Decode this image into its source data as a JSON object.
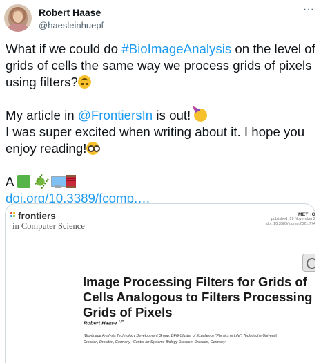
{
  "author": {
    "name": "Robert Haase",
    "handle": "@haesleinhuepf"
  },
  "more_icon": "more-horizontal-icon",
  "tweet": {
    "line1_pre": "What if we could do ",
    "hashtag": "#BioImageAnalysis",
    "line1_post": " on the level of grids of cells the same way we process grids of pixels using filters?",
    "line2_pre": "My article in ",
    "mention": "@FrontiersIn",
    "line2_post": " is out!",
    "line3": "I was super excited when writing about it. I hope you enjoy reading!",
    "line4_pre": "A ",
    "link": "doi.org/10.3389/fcomp.…",
    "link_color": "#1d9bf0",
    "emojis": [
      "upside-down-face",
      "partying-face",
      "nerd-face",
      "green-square",
      "microbe",
      "desktop-computer",
      "thread"
    ]
  },
  "card": {
    "journal_word": "frontiers",
    "journal_sub": "in Computer Science",
    "article_type": "METHO",
    "published": "published: 19 November 2",
    "doi": "doi: 10.3389/fcomp.2021.774",
    "title_lines": [
      "Image Processing Filters for Grids of",
      "Cells Analogous to Filters Processing",
      "Grids of Pixels"
    ],
    "author_name": "Robert Haase",
    "author_sup": "1,2*",
    "affiliations": [
      "¹Bio-image Analysis Technology Development Group, DFG Cluster of Excellence “Physics of Life”, Technische Universit",
      "Dresden, Dresden, Germany, ²Center for Systems Biology Dresden, Dresden, Germany"
    ]
  }
}
